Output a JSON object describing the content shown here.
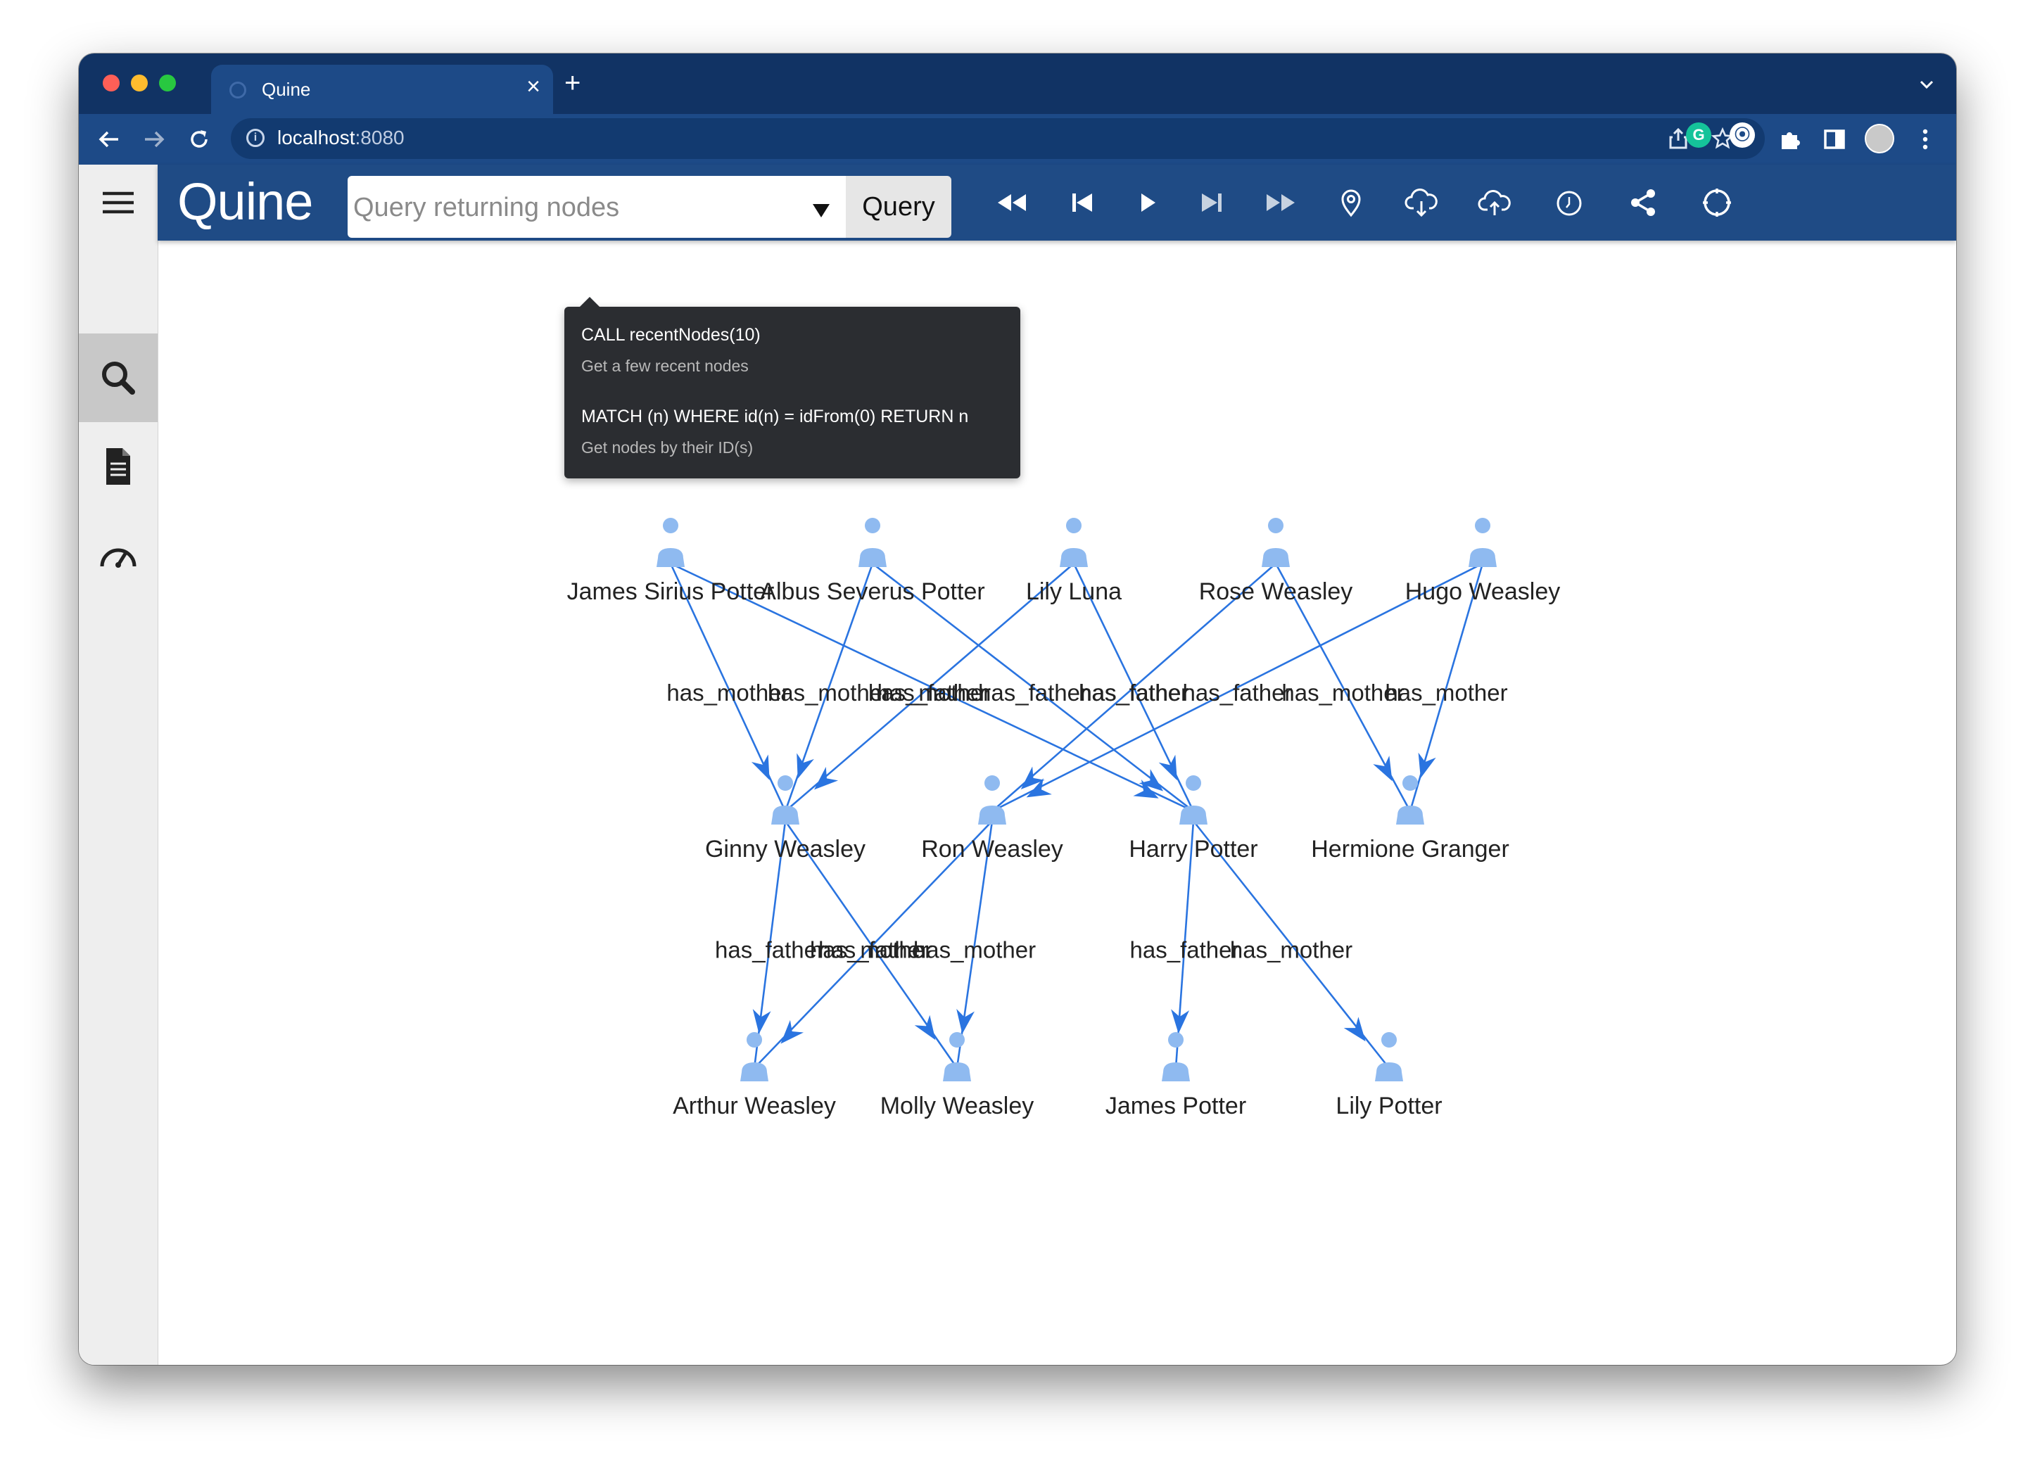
{
  "browser": {
    "tab_title": "Quine",
    "url_host": "localhost",
    "url_port": ":8080"
  },
  "app": {
    "logo": "Quine",
    "query_placeholder": "Query returning nodes",
    "query_button": "Query",
    "toolbar_icons": [
      "rewind-icon",
      "skip-back-icon",
      "play-icon",
      "skip-forward-icon",
      "fast-forward-icon",
      "location-pin-icon",
      "cloud-download-icon",
      "cloud-upload-icon",
      "timer-icon",
      "share-icon",
      "crosshair-icon"
    ],
    "sidebar_icons": [
      "menu-icon",
      "search-icon",
      "document-icon",
      "speedometer-icon"
    ]
  },
  "suggestions": [
    {
      "query": "CALL recentNodes(10)",
      "description": "Get a few recent nodes"
    },
    {
      "query": "MATCH (n) WHERE id(n) = idFrom(0) RETURN n",
      "description": "Get nodes by their ID(s)"
    }
  ],
  "colors": {
    "title_bar": "#113364",
    "app_bar": "#1f4b85",
    "node": "#8fbaf0",
    "edge": "#2a74e0"
  },
  "graph": {
    "nodes": [
      {
        "id": "james_sirius",
        "label": "James Sirius Potter"
      },
      {
        "id": "albus",
        "label": "Albus Severus Potter"
      },
      {
        "id": "lily_luna",
        "label": "Lily Luna"
      },
      {
        "id": "rose",
        "label": "Rose Weasley"
      },
      {
        "id": "hugo",
        "label": "Hugo Weasley"
      },
      {
        "id": "ginny",
        "label": "Ginny Weasley"
      },
      {
        "id": "ron",
        "label": "Ron Weasley"
      },
      {
        "id": "harry",
        "label": "Harry Potter"
      },
      {
        "id": "hermione",
        "label": "Hermione Granger"
      },
      {
        "id": "arthur",
        "label": "Arthur Weasley"
      },
      {
        "id": "molly",
        "label": "Molly Weasley"
      },
      {
        "id": "james",
        "label": "James Potter"
      },
      {
        "id": "lily",
        "label": "Lily Potter"
      }
    ],
    "edges": [
      {
        "from": "james_sirius",
        "to": "ginny",
        "label": "has_mother"
      },
      {
        "from": "albus",
        "to": "ginny",
        "label": "has_mother"
      },
      {
        "from": "lily_luna",
        "to": "ginny",
        "label": "has_mother"
      },
      {
        "from": "james_sirius",
        "to": "harry",
        "label": "has_father"
      },
      {
        "from": "albus",
        "to": "harry",
        "label": "has_father"
      },
      {
        "from": "lily_luna",
        "to": "harry",
        "label": "has_father"
      },
      {
        "from": "rose",
        "to": "ron",
        "label": "has_father"
      },
      {
        "from": "hugo",
        "to": "ron",
        "label": "has_father"
      },
      {
        "from": "rose",
        "to": "hermione",
        "label": "has_mother"
      },
      {
        "from": "hugo",
        "to": "hermione",
        "label": "has_mother"
      },
      {
        "from": "ginny",
        "to": "arthur",
        "label": "has_father"
      },
      {
        "from": "ron",
        "to": "arthur",
        "label": "has_father"
      },
      {
        "from": "ginny",
        "to": "molly",
        "label": "has_mother"
      },
      {
        "from": "ron",
        "to": "molly",
        "label": "has_mother"
      },
      {
        "from": "harry",
        "to": "james",
        "label": "has_father"
      },
      {
        "from": "harry",
        "to": "lily",
        "label": "has_mother"
      }
    ]
  }
}
